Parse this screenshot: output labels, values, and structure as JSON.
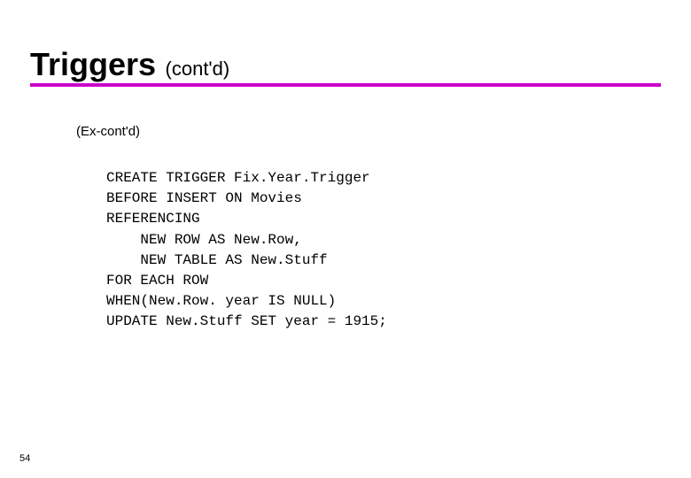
{
  "title": {
    "main": "Triggers",
    "sub": "(cont'd)"
  },
  "subhead": "(Ex-cont'd)",
  "code": {
    "l1": "CREATE TRIGGER Fix.Year.Trigger",
    "l2": "BEFORE INSERT ON Movies",
    "l3": "REFERENCING",
    "l4": "    NEW ROW AS New.Row,",
    "l5": "    NEW TABLE AS New.Stuff",
    "l6": "FOR EACH ROW",
    "l7": "WHEN(New.Row. year IS NULL)",
    "l8": "UPDATE New.Stuff SET year = 1915;"
  },
  "page_number": "54",
  "accent_color": "#cc00cc"
}
